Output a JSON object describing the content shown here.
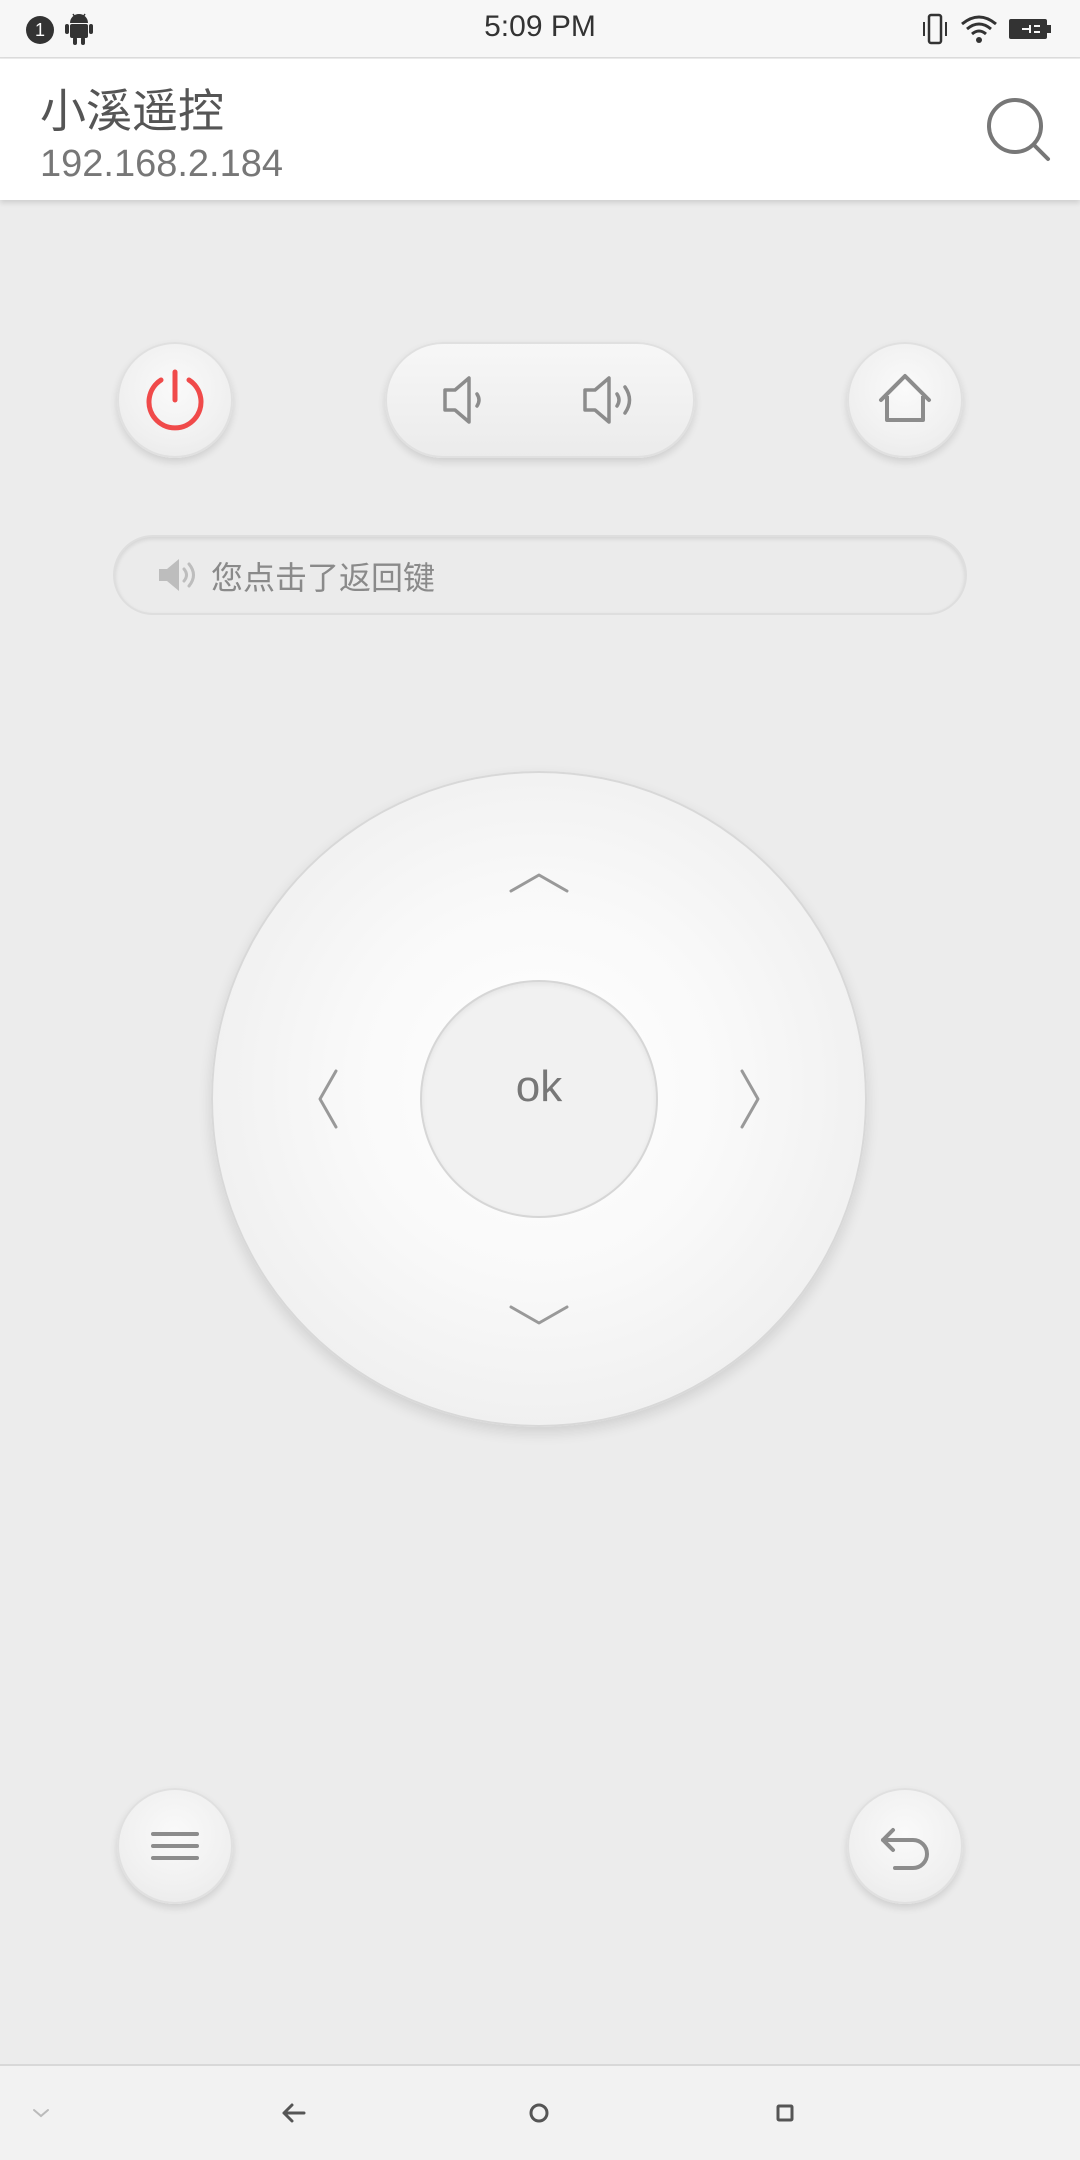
{
  "status_bar": {
    "notification_count": "1",
    "time": "5:09 PM",
    "icons": [
      "android-icon",
      "vibrate-icon",
      "wifi-icon",
      "battery-charging-icon"
    ]
  },
  "header": {
    "title": "小溪遥控",
    "ip": "192.168.2.184",
    "search_icon": "search-icon"
  },
  "controls": {
    "power_icon": "power-icon",
    "power_color": "#f04a4a",
    "volume_down_icon": "volume-down-icon",
    "volume_up_icon": "volume-up-icon",
    "home_icon": "home-icon",
    "menu_icon": "menu-icon",
    "back_icon": "back-icon"
  },
  "toast": {
    "icon": "speaker-icon",
    "message": "您点击了返回键"
  },
  "dpad": {
    "ok_label": "ok",
    "arrows": [
      "up",
      "down",
      "left",
      "right"
    ]
  },
  "nav_bar": {
    "items": [
      "hide-keyboard-icon",
      "back-arrow-icon",
      "home-circle-icon",
      "recents-square-icon"
    ]
  },
  "colors": {
    "background": "#ececec",
    "header": "#ffffff",
    "icon_gray": "#8c8c8c",
    "power_red": "#f04a4a"
  }
}
